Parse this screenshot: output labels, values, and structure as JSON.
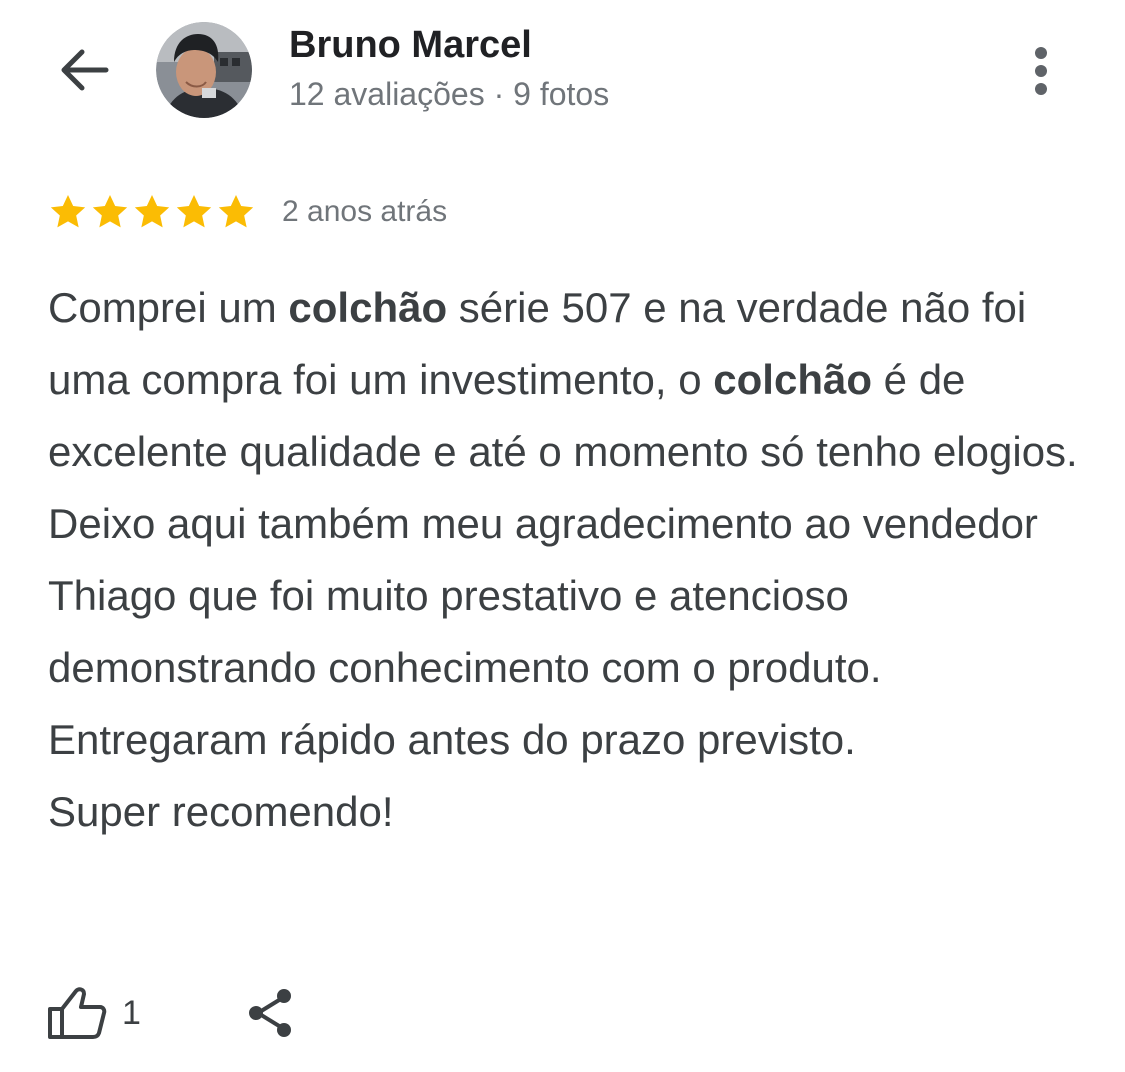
{
  "header": {
    "back_icon": "arrow-back-icon",
    "avatar_icon": "user-avatar",
    "reviewer_name": "Bruno Marcel",
    "reviewer_meta": "12 avaliações · 9 fotos",
    "more_icon": "more-vert-icon"
  },
  "review": {
    "rating": 5,
    "rating_max": 5,
    "star_color": "#fbbc04",
    "time_ago": "2 anos atrás",
    "segments": [
      {
        "text": "Comprei um ",
        "bold": false
      },
      {
        "text": "colchão",
        "bold": true
      },
      {
        "text": " série 507 e na verdade ",
        "bold": false
      },
      {
        "text": "não foi uma compra foi um investimento, o ",
        "bold": false
      },
      {
        "text": "colchão",
        "bold": true
      },
      {
        "text": " é de excelente qualidade e até o ",
        "bold": false
      },
      {
        "text": "momento só tenho elogios. Deixo aqui também ",
        "bold": false
      },
      {
        "text": "meu agradecimento ao vendedor Thiago que ",
        "bold": false
      },
      {
        "text": "foi muito prestativo e atencioso demonstrando ",
        "bold": false
      },
      {
        "text": "conhecimento com o produto. Entregaram ",
        "bold": false
      },
      {
        "text": "rápido antes do prazo previsto.",
        "bold": false
      },
      {
        "text": "Super recomendo!",
        "bold": false,
        "break_before": true
      }
    ]
  },
  "actions": {
    "like_icon": "thumb-up-icon",
    "like_count": "1",
    "share_icon": "share-icon"
  }
}
